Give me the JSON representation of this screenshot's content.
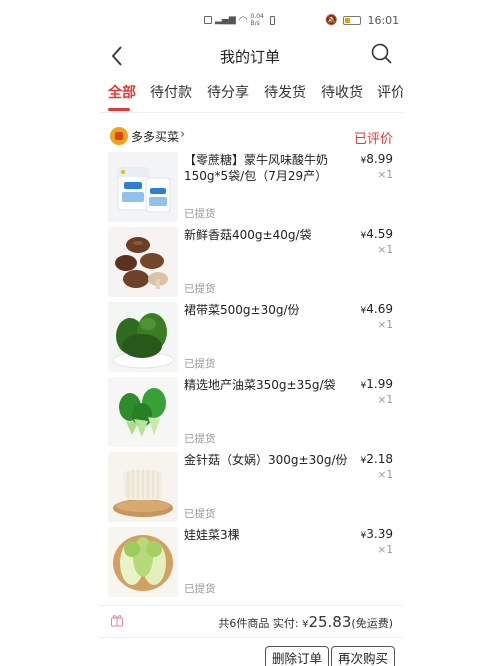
{
  "status_bar": {
    "network_speed": "0.04 B/s",
    "time": "16:01"
  },
  "header": {
    "title": "我的订单"
  },
  "tabs": [
    {
      "label": "全部",
      "active": true
    },
    {
      "label": "待付款",
      "active": false
    },
    {
      "label": "待分享",
      "active": false
    },
    {
      "label": "待发货",
      "active": false
    },
    {
      "label": "待收货",
      "active": false
    },
    {
      "label": "评价",
      "active": false
    }
  ],
  "order": {
    "store_name": "多多买菜",
    "status": "已评价",
    "items": [
      {
        "name": "【零蔗糖】蒙牛风味酸牛奶150g*5袋/包（7月29产）",
        "price": "8.99",
        "qty": "×1",
        "pickup": "已提货",
        "thumb": "yogurt-pack"
      },
      {
        "name": "新鲜香菇400g±40g/袋",
        "price": "4.59",
        "qty": "×1",
        "pickup": "已提货",
        "thumb": "shiitake-mushroom"
      },
      {
        "name": "裙带菜500g±30g/份",
        "price": "4.69",
        "qty": "×1",
        "pickup": "已提货",
        "thumb": "seaweed"
      },
      {
        "name": "精选地产油菜350g±35g/袋",
        "price": "1.99",
        "qty": "×1",
        "pickup": "已提货",
        "thumb": "bok-choy"
      },
      {
        "name": "金针菇（女娲）300g±30g/份",
        "price": "2.18",
        "qty": "×1",
        "pickup": "已提货",
        "thumb": "enoki-mushroom"
      },
      {
        "name": "娃娃菜3棵",
        "price": "3.39",
        "qty": "×1",
        "pickup": "已提货",
        "thumb": "baby-cabbage"
      }
    ],
    "summary": {
      "count_text": "共6件商品",
      "paid_label": "实付:",
      "currency": "¥",
      "total": "25.83",
      "shipping_note": "(免运费)"
    }
  },
  "actions": {
    "delete_label": "删除订单",
    "rebuy_label": "再次购买"
  },
  "currency_symbol": "¥",
  "colors": {
    "accent": "#e53935"
  }
}
